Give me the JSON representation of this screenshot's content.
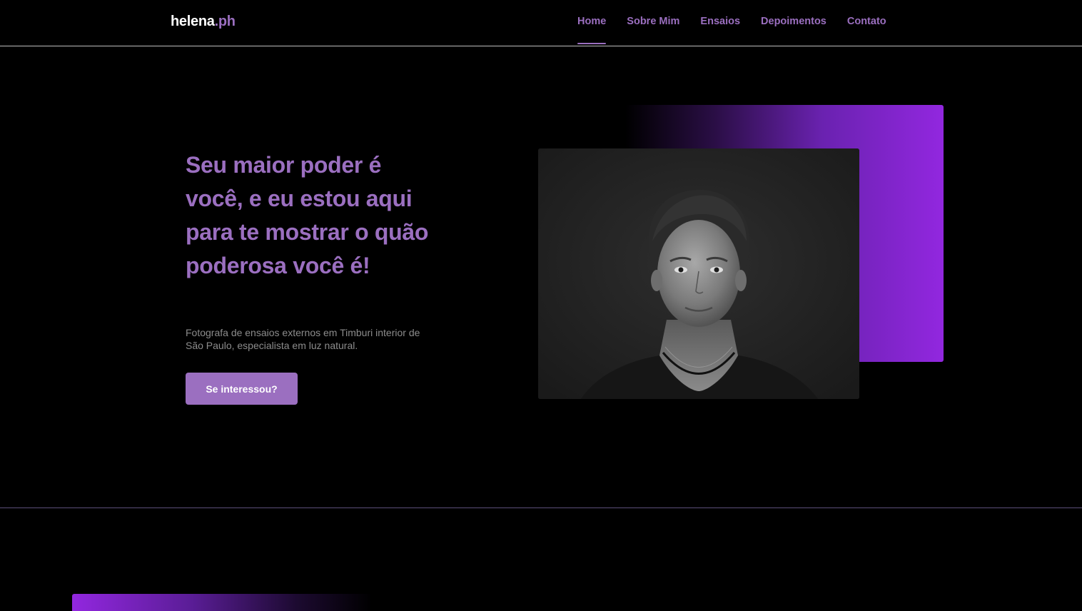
{
  "header": {
    "logo_main": "helena",
    "logo_accent": ".ph",
    "nav": [
      {
        "label": "Home",
        "active": true
      },
      {
        "label": "Sobre Mim",
        "active": false
      },
      {
        "label": "Ensaios",
        "active": false
      },
      {
        "label": "Depoimentos",
        "active": false
      },
      {
        "label": "Contato",
        "active": false
      }
    ]
  },
  "hero": {
    "title": "Seu maior poder é você, e eu estou aqui para te mostrar o quão poderosa você é!",
    "subtitle": "Fotografa de ensaios externos em Timburi interior de São Paulo, especialista em luz natural.",
    "cta_label": "Se interessou?"
  },
  "colors": {
    "accent": "#9b6fc0",
    "gradient_purple": "#9227df",
    "background": "#000000"
  }
}
